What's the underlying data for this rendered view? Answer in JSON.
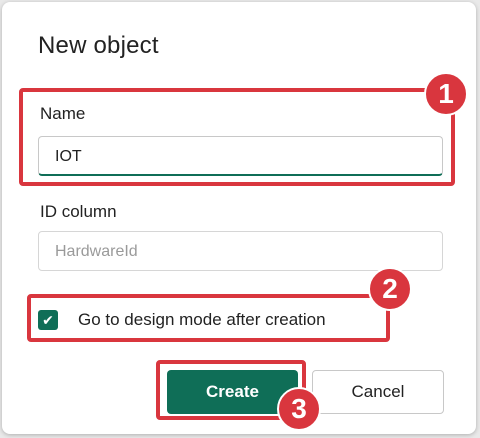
{
  "dialog": {
    "title": "New object",
    "name_field": {
      "label": "Name",
      "value": "IOT"
    },
    "id_column_field": {
      "label": "ID column",
      "placeholder": "HardwareId"
    },
    "design_mode_checkbox": {
      "label": "Go to design mode after creation",
      "checked": true,
      "check_glyph": "✔"
    },
    "buttons": {
      "create": "Create",
      "cancel": "Cancel"
    }
  },
  "annotations": {
    "step1": "1",
    "step2": "2",
    "step3": "3"
  },
  "colors": {
    "accent": "#0f6e57",
    "highlight": "#d9363e"
  }
}
